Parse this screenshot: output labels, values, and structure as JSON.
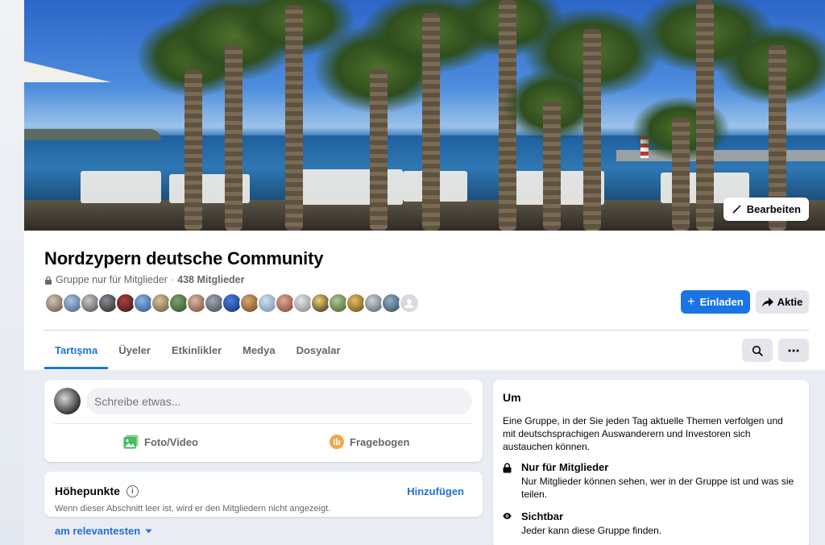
{
  "cover": {
    "edit_label": "Bearbeiten"
  },
  "group": {
    "name": "Nordzypern deutsche Community",
    "privacy": "Gruppe nur für Mitglieder",
    "separator": "·",
    "members_count": "438 Mitglieder"
  },
  "actions": {
    "invite_label": "Einladen",
    "share_label": "Aktie"
  },
  "tabs": [
    {
      "label": "Tartışma",
      "active": true
    },
    {
      "label": "Üyeler",
      "active": false
    },
    {
      "label": "Etkinlikler",
      "active": false
    },
    {
      "label": "Medya",
      "active": false
    },
    {
      "label": "Dosyalar",
      "active": false
    }
  ],
  "composer": {
    "placeholder": "Schreibe etwas...",
    "photo_label": "Foto/Video",
    "poll_label": "Fragebogen"
  },
  "highlights": {
    "title": "Höhepunkte",
    "add_label": "Hinzufügen",
    "description": "Wenn dieser Abschnitt leer ist, wird er den Mitgliedern nicht angezeigt."
  },
  "feed": {
    "sort_label": "am relevantesten"
  },
  "about": {
    "title": "Um",
    "description": "Eine Gruppe, in der Sie jeden Tag aktuelle Themen verfolgen und mit deutschsprachigen Auswanderern und Investoren sich austauchen können.",
    "private_title": "Nur für Mitglieder",
    "private_desc": "Nur Mitglieder können sehen, wer in der Gruppe ist und was sie teilen.",
    "visible_title": "Sichtbar",
    "visible_desc": "Jeder kann diese Gruppe finden."
  },
  "colors": {
    "accent": "#1b74e4",
    "link": "#216fdb",
    "secondary_text": "#65676b",
    "button_gray": "#e4e6eb",
    "page_bg": "#e9edf3"
  }
}
